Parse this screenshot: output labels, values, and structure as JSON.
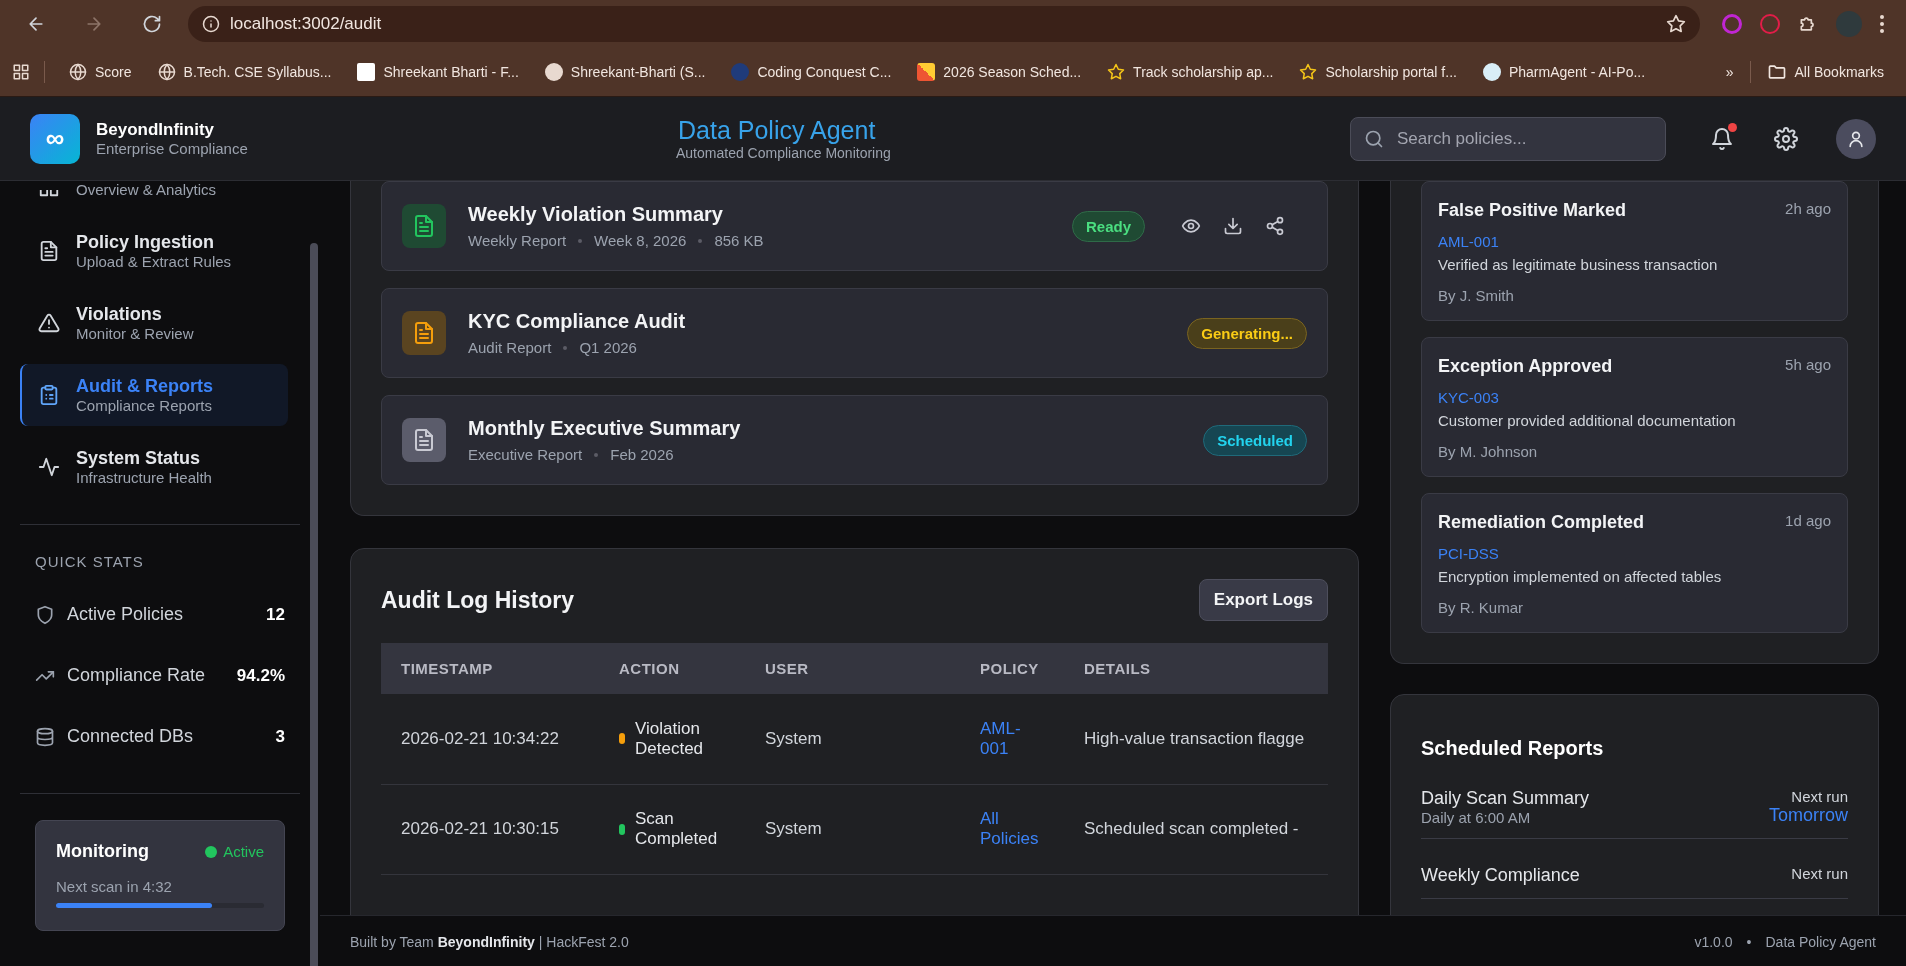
{
  "browser": {
    "url": "localhost:3002/audit",
    "forward_disabled": true,
    "bookmarks": [
      {
        "label": "Score",
        "kind": "globe"
      },
      {
        "label": "B.Tech. CSE Syllabus...",
        "kind": "globe"
      },
      {
        "label": "Shreekant Bharti - F...",
        "kind": "square"
      },
      {
        "label": "Shreekant-Bharti (S...",
        "kind": "github"
      },
      {
        "label": "Coding Conquest C...",
        "kind": "circle"
      },
      {
        "label": "2026 Season Sched...",
        "kind": "blocks"
      },
      {
        "label": "Track scholarship ap...",
        "kind": "star"
      },
      {
        "label": "Scholarship portal f...",
        "kind": "star"
      },
      {
        "label": "PharmAgent - AI-Po...",
        "kind": "shield"
      }
    ],
    "overflow": "»",
    "all_bookmarks": "All Bookmarks"
  },
  "header": {
    "logo_symbol": "∞",
    "brand": "BeyondInfinity",
    "tagline": "Enterprise Compliance",
    "title": "Data Policy Agent",
    "subtitle": "Automated Compliance Monitoring",
    "search": {
      "placeholder": "Search policies..."
    },
    "unread_notifications": true
  },
  "sidebar": {
    "items": [
      {
        "kind": "grid",
        "subtitle": "Overview & Analytics",
        "selected": false
      },
      {
        "kind": "doc",
        "title": "Policy Ingestion",
        "subtitle": "Upload & Extract Rules",
        "selected": false
      },
      {
        "kind": "warning",
        "title": "Violations",
        "subtitle": "Monitor & Review",
        "selected": false
      },
      {
        "kind": "clipboard",
        "title": "Audit & Reports",
        "subtitle": "Compliance Reports",
        "selected": true
      },
      {
        "kind": "pulse",
        "title": "System Status",
        "subtitle": "Infrastructure Health",
        "selected": false
      }
    ],
    "quick_stats": {
      "heading": "QUICK STATS",
      "items": [
        {
          "kind": "shield",
          "label": "Active Policies",
          "value": "12"
        },
        {
          "kind": "trend",
          "label": "Compliance Rate",
          "value": "94.2%"
        },
        {
          "kind": "database",
          "label": "Connected DBs",
          "value": "3"
        }
      ]
    },
    "monitoring": {
      "title": "Monitoring",
      "status": "Active",
      "active": true,
      "next_scan": "Next scan in 4:32",
      "level": 0.75
    }
  },
  "reports": [
    {
      "title": "Weekly Violation Summary",
      "meta": [
        "Weekly Report",
        "Week 8, 2026",
        "856 KB"
      ],
      "status": "Ready",
      "kind": "ready",
      "actions": true
    },
    {
      "title": "KYC Compliance Audit",
      "meta": [
        "Audit Report",
        "Q1 2026"
      ],
      "status": "Generating...",
      "kind": "generating",
      "actions": false
    },
    {
      "title": "Monthly Executive Summary",
      "meta": [
        "Executive Report",
        "Feb 2026"
      ],
      "status": "Scheduled",
      "kind": "scheduled",
      "actions": false
    }
  ],
  "audit_log": {
    "title": "Audit Log History",
    "export_button": "Export Logs",
    "columns": [
      "TIMESTAMP",
      "ACTION",
      "USER",
      "POLICY",
      "DETAILS"
    ],
    "rows": [
      {
        "timestamp": "2026-02-21 10:34:22",
        "action": "Violation Detected",
        "color": "#f59e0b",
        "user": "System",
        "policy": "AML-001",
        "details": "High-value transaction flagge"
      },
      {
        "timestamp": "2026-02-21 10:30:15",
        "action": "Scan Completed",
        "color": "#22c55e",
        "user": "System",
        "policy": "All Policies",
        "details": "Scheduled scan completed - "
      }
    ]
  },
  "activity": [
    {
      "title": "False Positive Marked",
      "time": "2h ago",
      "policy": "AML-001",
      "note": "Verified as legitimate business transaction",
      "by": "By J. Smith"
    },
    {
      "title": "Exception Approved",
      "time": "5h ago",
      "policy": "KYC-003",
      "note": "Customer provided additional documentation",
      "by": "By M. Johnson"
    },
    {
      "title": "Remediation Completed",
      "time": "1d ago",
      "policy": "PCI-DSS",
      "note": "Encryption implemented on affected tables",
      "by": "By R. Kumar"
    }
  ],
  "scheduled_reports": {
    "title": "Scheduled Reports",
    "items": [
      {
        "name": "Daily Scan Summary",
        "schedule": "Daily at 6:00 AM",
        "next_label": "Next run",
        "next": "Tomorrow"
      },
      {
        "name": "Weekly Compliance",
        "next_label": "Next run"
      }
    ]
  },
  "footer": {
    "credit": "Built by Team **BeyondInfinity** | HackFest 2.0",
    "version": "v1.0.0",
    "separator": "•",
    "app_name": "Data Policy Agent"
  }
}
